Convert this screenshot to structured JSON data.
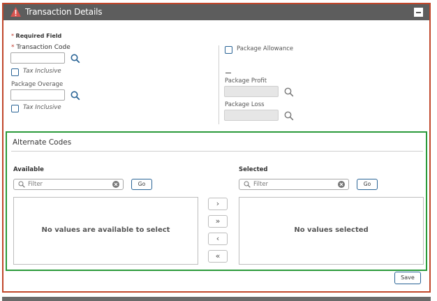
{
  "panel": {
    "title": "Transaction Details"
  },
  "form": {
    "required_note_star": "*",
    "required_note": "Required Field",
    "transaction_code_label": "Transaction Code",
    "transaction_code_value": "",
    "tax_inclusive_1": "Tax Inclusive",
    "package_overage_label": "Package Overage",
    "package_overage_value": "",
    "tax_inclusive_2": "Tax Inclusive",
    "package_allowance": "Package Allowance",
    "package_profit_label": "Package Profit",
    "package_loss_label": "Package Loss"
  },
  "alternate_codes": {
    "title": "Alternate Codes",
    "available_title": "Available",
    "selected_title": "Selected",
    "filter_placeholder": "Filter",
    "go_label": "Go",
    "available_empty": "No values are available to select",
    "selected_empty": "No values selected",
    "shuttle": {
      "move_right": "›",
      "move_all_right": "»",
      "move_left": "‹",
      "move_all_left": "«"
    }
  },
  "footer": {
    "save_label": "Save"
  },
  "colors": {
    "titlebar": "#5d5d5d",
    "panel_border": "#c0462a",
    "alt_border": "#2a9a3a",
    "accent": "#2a6496",
    "warning": "#d9534f"
  },
  "icons": [
    "warning-icon",
    "collapse-icon",
    "search-icon",
    "clear-icon"
  ]
}
